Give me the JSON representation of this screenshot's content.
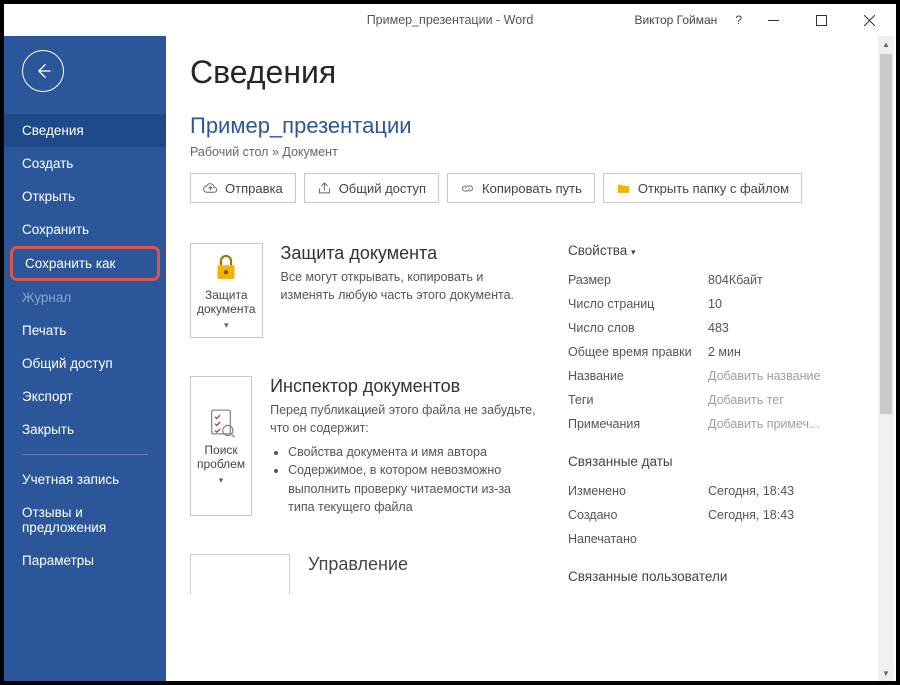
{
  "window": {
    "title": "Пример_презентации  -  Word",
    "user": "Виктор Гойман",
    "help": "?"
  },
  "sidebar": {
    "items": [
      {
        "label": "Сведения",
        "state": "active"
      },
      {
        "label": "Создать"
      },
      {
        "label": "Открыть"
      },
      {
        "label": "Сохранить"
      },
      {
        "label": "Сохранить как",
        "state": "highlighted"
      },
      {
        "label": "Журнал",
        "state": "disabled"
      },
      {
        "label": "Печать"
      },
      {
        "label": "Общий доступ"
      },
      {
        "label": "Экспорт"
      },
      {
        "label": "Закрыть"
      }
    ],
    "footer": [
      {
        "label": "Учетная запись"
      },
      {
        "label": "Отзывы и предложения"
      },
      {
        "label": "Параметры"
      }
    ]
  },
  "page": {
    "heading": "Сведения",
    "doc_title": "Пример_презентации",
    "breadcrumb": "Рабочий стол » Документ"
  },
  "toolbar": {
    "send": "Отправка",
    "share": "Общий доступ",
    "copy_path": "Копировать путь",
    "open_folder": "Открыть папку с файлом"
  },
  "cards": {
    "protect": {
      "btn": "Защита документа",
      "title": "Защита документа",
      "desc": "Все могут открывать, копировать и изменять любую часть этого документа."
    },
    "inspect": {
      "btn": "Поиск проблем",
      "title": "Инспектор документов",
      "desc": "Перед публикацией этого файла не забудьте, что он содержит:",
      "li1": "Свойства документа и имя автора",
      "li2": "Содержимое, в котором невозможно выполнить проверку читаемости из-за типа текущего файла"
    },
    "manage": {
      "title": "Управление"
    }
  },
  "props": {
    "heading": "Свойства",
    "rows": [
      {
        "k": "Размер",
        "v": "804Кбайт"
      },
      {
        "k": "Число страниц",
        "v": "10"
      },
      {
        "k": "Число слов",
        "v": "483"
      },
      {
        "k": "Общее время правки",
        "v": "2 мин"
      },
      {
        "k": "Название",
        "v": "Добавить название",
        "hint": true
      },
      {
        "k": "Теги",
        "v": "Добавить тег",
        "hint": true
      },
      {
        "k": "Примечания",
        "v": "Добавить примеч...",
        "hint": true
      }
    ],
    "dates_heading": "Связанные даты",
    "dates": [
      {
        "k": "Изменено",
        "v": "Сегодня, 18:43"
      },
      {
        "k": "Создано",
        "v": "Сегодня, 18:43"
      },
      {
        "k": "Напечатано",
        "v": ""
      }
    ],
    "users_heading": "Связанные пользователи"
  }
}
